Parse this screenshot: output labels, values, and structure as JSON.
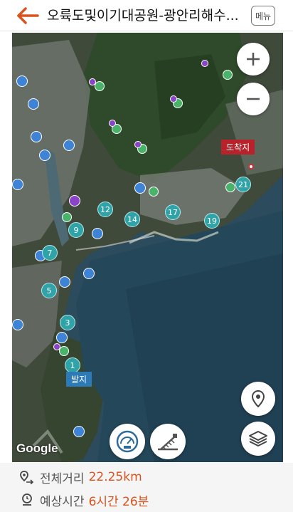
{
  "header": {
    "title": "오륙도및이기대공원-광안리해수...",
    "menu_label": "메뉴"
  },
  "map": {
    "attribution": "Google",
    "end_label": "도착지",
    "start_label": "발지",
    "waypoints": [
      "1",
      "3",
      "5",
      "7",
      "9",
      "12",
      "14",
      "17",
      "19",
      "21"
    ]
  },
  "summary": {
    "distance_label": "전체거리",
    "distance_value": "22.25km",
    "time_label": "예상시간",
    "time_value": "6시간 26분"
  },
  "colors": {
    "accent": "#d9531e",
    "route_marker": "#2fa3a8",
    "end_flag": "#b8232b",
    "start_flag": "#2c7ab8"
  }
}
